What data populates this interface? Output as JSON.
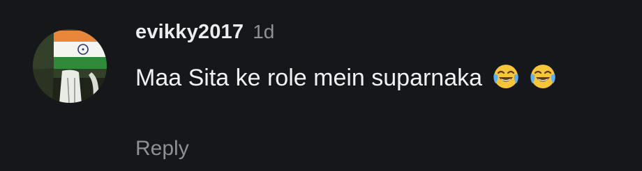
{
  "comment": {
    "username": "evikky2017",
    "time_ago": "1d",
    "text": "Maa Sita ke role mein suparnaka",
    "emojis": [
      "face-with-tears-of-joy-icon",
      "face-with-tears-of-joy-icon"
    ],
    "reply_label": "Reply"
  },
  "colors": {
    "background": "#16171b",
    "text_primary": "#f1f2f3",
    "text_secondary": "#8f9095",
    "flag_saffron": "#e8873a",
    "flag_green": "#2f8a3a"
  }
}
